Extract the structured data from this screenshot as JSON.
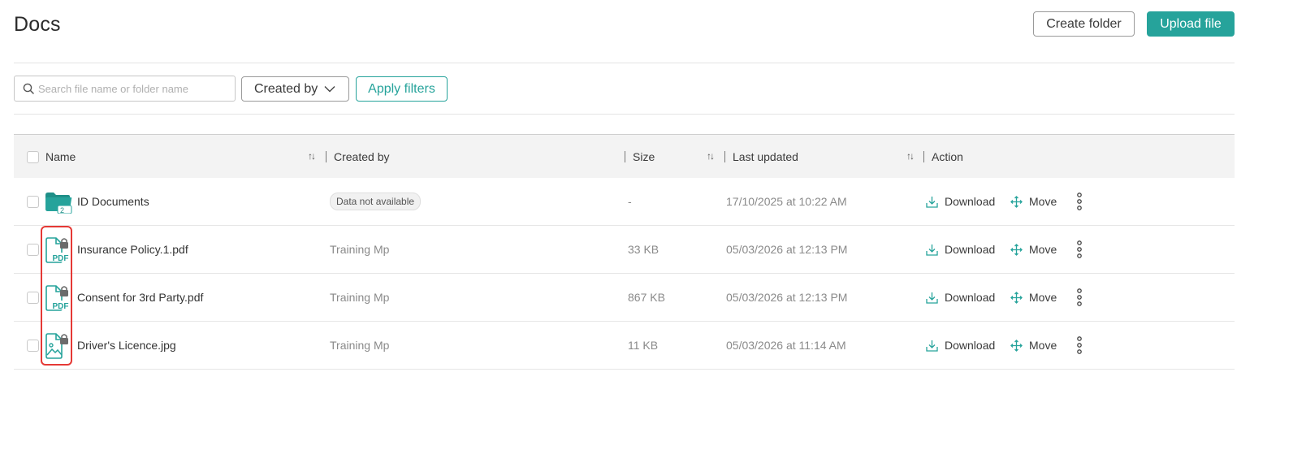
{
  "page": {
    "title": "Docs"
  },
  "header": {
    "create_folder_label": "Create folder",
    "upload_file_label": "Upload file"
  },
  "filters": {
    "search_placeholder": "Search file name or folder name",
    "search_value": "",
    "created_by_label": "Created by",
    "apply_label": "Apply filters"
  },
  "table": {
    "columns": {
      "name": "Name",
      "created_by": "Created by",
      "size": "Size",
      "last_updated": "Last updated",
      "action": "Action"
    },
    "rows": [
      {
        "icon": "folder-icon",
        "folder_count": "2",
        "name": "ID Documents",
        "created_by": "Data not available",
        "size": "-",
        "last_updated": "17/10/2025 at 10:22 AM",
        "download": "Download",
        "move": "Move"
      },
      {
        "icon": "locked-pdf-icon",
        "name": "Insurance Policy.1.pdf",
        "created_by": "Training Mp",
        "size": "33 KB",
        "last_updated": "05/03/2026 at 12:13 PM",
        "download": "Download",
        "move": "Move"
      },
      {
        "icon": "locked-pdf-icon",
        "name": "Consent for 3rd Party.pdf",
        "created_by": "Training Mp",
        "size": "867 KB",
        "last_updated": "05/03/2026 at 12:13 PM",
        "download": "Download",
        "move": "Move"
      },
      {
        "icon": "locked-image-icon",
        "name": "Driver's Licence.jpg",
        "created_by": "Training Mp",
        "size": "11 KB",
        "last_updated": "05/03/2026 at 11:14 AM",
        "download": "Download",
        "move": "Move"
      }
    ]
  },
  "colors": {
    "accent": "#26a39b",
    "highlight": "#e53935",
    "lock": "#6b6b6b"
  }
}
